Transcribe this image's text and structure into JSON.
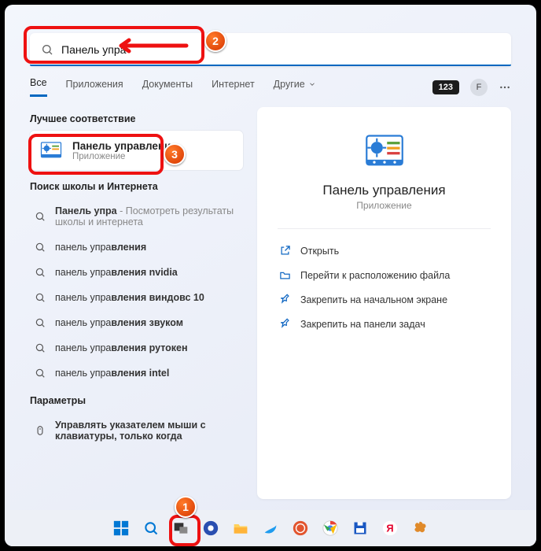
{
  "search": {
    "value": "Панель упра"
  },
  "tabs": {
    "items": [
      {
        "label": "Все",
        "active": true
      },
      {
        "label": "Приложения"
      },
      {
        "label": "Документы"
      },
      {
        "label": "Интернет"
      },
      {
        "label": "Другие",
        "chevron": true
      }
    ],
    "badge": "123",
    "avatar": "F"
  },
  "best": {
    "heading": "Лучшее соответствие",
    "title": "Панель управления",
    "subtitle": "Приложение"
  },
  "web": {
    "heading": "Поиск школы и Интернета",
    "items": [
      {
        "prefix": "Панель упра",
        "bold": "",
        "sub": " - Посмотреть результаты школы и интернета"
      },
      {
        "prefix": "панель упра",
        "bold": "вления"
      },
      {
        "prefix": "панель упра",
        "bold": "вления nvidia"
      },
      {
        "prefix": "панель упра",
        "bold": "вления виндовс 10"
      },
      {
        "prefix": "панель упра",
        "bold": "вления звуком"
      },
      {
        "prefix": "панель упра",
        "bold": "вления рутокен"
      },
      {
        "prefix": "панель упра",
        "bold": "вления intel"
      }
    ]
  },
  "settings": {
    "heading": "Параметры",
    "item_prefix": "Упра",
    "item_bold": "влять указателем мыши с клавиатуры, только когда"
  },
  "preview": {
    "title": "Панель управления",
    "subtitle": "Приложение",
    "actions": [
      {
        "icon": "open",
        "label": "Открыть"
      },
      {
        "icon": "folder",
        "label": "Перейти к расположению файла"
      },
      {
        "icon": "pin",
        "label": "Закрепить на начальном экране"
      },
      {
        "icon": "pin",
        "label": "Закрепить на панели задач"
      }
    ]
  },
  "annotations": {
    "n1": "1",
    "n2": "2",
    "n3": "3"
  }
}
